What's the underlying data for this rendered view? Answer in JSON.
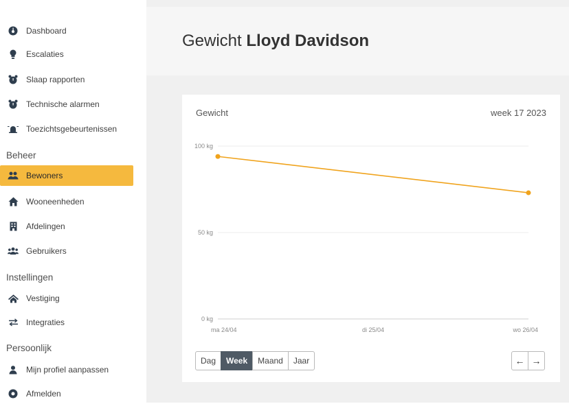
{
  "sidebar": {
    "items": [
      {
        "label": "Dashboard",
        "icon": "dashboard-icon"
      },
      {
        "label": "Escalaties",
        "icon": "lightbulb-icon"
      },
      {
        "label": "Slaap rapporten",
        "icon": "alarm-clock-icon"
      },
      {
        "label": "Technische alarmen",
        "icon": "alarm-clock-icon"
      },
      {
        "label": "Toezichtsgebeurtenissen",
        "icon": "siren-icon"
      }
    ],
    "beheer_heading": "Beheer",
    "beheer_items": [
      {
        "label": "Bewoners",
        "icon": "residents-icon",
        "active": true
      },
      {
        "label": "Wooneenheden",
        "icon": "house-icon"
      },
      {
        "label": "Afdelingen",
        "icon": "building-icon"
      },
      {
        "label": "Gebruikers",
        "icon": "users-icon"
      }
    ],
    "instellingen_heading": "Instellingen",
    "instellingen_items": [
      {
        "label": "Vestiging",
        "icon": "home-icon"
      },
      {
        "label": "Integraties",
        "icon": "swap-icon"
      }
    ],
    "persoonlijk_heading": "Persoonlijk",
    "persoonlijk_items": [
      {
        "label": "Mijn profiel aanpassen",
        "icon": "user-icon"
      },
      {
        "label": "Afmelden",
        "icon": "power-icon"
      }
    ]
  },
  "header": {
    "title_prefix": "Gewicht",
    "title_name": "Lloyd Davidson"
  },
  "card": {
    "title": "Gewicht",
    "period": "week 17 2023"
  },
  "chart_data": {
    "type": "line",
    "title": "",
    "x": [
      "ma 24/04",
      "di 25/04",
      "wo 26/04"
    ],
    "y_ticks": [
      "100 kg",
      "50 kg",
      "0 kg"
    ],
    "ylim": [
      0,
      100
    ],
    "series": [
      {
        "points": [
          {
            "x": "ma 24/04",
            "y": 94
          },
          {
            "x": "wo 26/04",
            "y": 73
          }
        ],
        "color": "#f0a31c"
      }
    ],
    "grid": true
  },
  "range_buttons": [
    "Dag",
    "Week",
    "Maand",
    "Jaar"
  ],
  "active_range": "Week",
  "nav": {
    "prev": "←",
    "next": "→"
  },
  "colors": {
    "accent": "#f5b93e",
    "line": "#f0a31c",
    "active_button": "#4f5a65"
  }
}
